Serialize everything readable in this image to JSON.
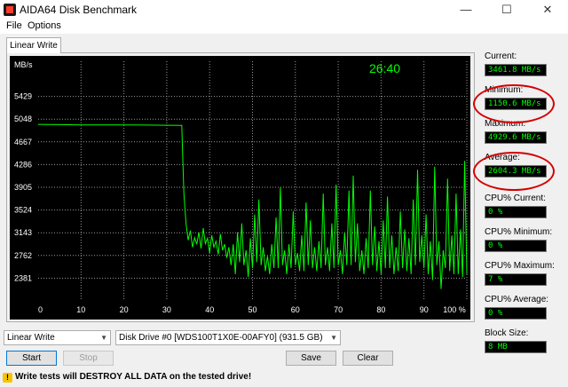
{
  "window": {
    "title": "AIDA64 Disk Benchmark",
    "minimize_glyph": "—",
    "maximize_glyph": "☐",
    "close_glyph": "✕"
  },
  "menu": {
    "items": [
      "File",
      "Options"
    ]
  },
  "tabs": [
    {
      "label": "Linear Write"
    }
  ],
  "chart": {
    "timer": "26:40",
    "y_unit": "MB/s",
    "line_color": "#00ff00",
    "background": "#000000",
    "grid_color": "#9a9a9a"
  },
  "chart_data": {
    "type": "line",
    "title": "",
    "xlabel": "",
    "ylabel": "MB/s",
    "xlim": [
      0,
      100
    ],
    "ylim": [
      2000,
      5810
    ],
    "grid": true,
    "x_ticks": [
      "0",
      "10",
      "20",
      "30",
      "40",
      "50",
      "60",
      "70",
      "80",
      "90",
      "100 %"
    ],
    "y_ticks": [
      "5429",
      "5048",
      "4667",
      "4286",
      "3905",
      "3524",
      "3143",
      "2762",
      "2381"
    ],
    "series": [
      {
        "color": "#00ff00",
        "points": [
          [
            0,
            4960
          ],
          [
            5,
            4955
          ],
          [
            10,
            4952
          ],
          [
            15,
            4950
          ],
          [
            20,
            4950
          ],
          [
            25,
            4948
          ],
          [
            30,
            4946
          ],
          [
            33.5,
            4944
          ],
          [
            34,
            3800
          ],
          [
            34.5,
            3300
          ],
          [
            35,
            3020
          ],
          [
            35.5,
            3180
          ],
          [
            36,
            2900
          ],
          [
            36.5,
            3060
          ],
          [
            37,
            2950
          ],
          [
            37.5,
            3150
          ],
          [
            38,
            2880
          ],
          [
            38.5,
            3220
          ],
          [
            39,
            2960
          ],
          [
            39.5,
            3050
          ],
          [
            40,
            2800
          ],
          [
            40.5,
            3100
          ],
          [
            41,
            2900
          ],
          [
            41.5,
            3000
          ],
          [
            42,
            2780
          ],
          [
            42.5,
            3120
          ],
          [
            43,
            2850
          ],
          [
            43.5,
            2950
          ],
          [
            44,
            2720
          ],
          [
            44.5,
            2900
          ],
          [
            45,
            2600
          ],
          [
            45.5,
            2950
          ],
          [
            46,
            2450
          ],
          [
            46.5,
            3150
          ],
          [
            47,
            2650
          ],
          [
            47.5,
            3300
          ],
          [
            48,
            2600
          ],
          [
            48.5,
            2850
          ],
          [
            49,
            2400
          ],
          [
            49.5,
            3050
          ],
          [
            50,
            2550
          ],
          [
            50.5,
            3450
          ],
          [
            51,
            2650
          ],
          [
            51.5,
            3700
          ],
          [
            52,
            2600
          ],
          [
            52.5,
            2900
          ],
          [
            53,
            2500
          ],
          [
            53.5,
            2750
          ],
          [
            54,
            2450
          ],
          [
            54.5,
            2950
          ],
          [
            55,
            2550
          ],
          [
            55.5,
            3400
          ],
          [
            56,
            2550
          ],
          [
            56.5,
            3900
          ],
          [
            57,
            2600
          ],
          [
            57.5,
            2850
          ],
          [
            58,
            2450
          ],
          [
            58.5,
            2950
          ],
          [
            59,
            2550
          ],
          [
            59.5,
            3500
          ],
          [
            60,
            2600
          ],
          [
            60.5,
            2800
          ],
          [
            61,
            2500
          ],
          [
            61.5,
            3100
          ],
          [
            62,
            2500
          ],
          [
            62.5,
            3650
          ],
          [
            63,
            2600
          ],
          [
            63.5,
            3350
          ],
          [
            64,
            2550
          ],
          [
            64.5,
            2900
          ],
          [
            65,
            2500
          ],
          [
            65.5,
            3000
          ],
          [
            66,
            2550
          ],
          [
            66.5,
            3800
          ],
          [
            67,
            2600
          ],
          [
            67.5,
            2900
          ],
          [
            68,
            2500
          ],
          [
            68.5,
            3300
          ],
          [
            69,
            2550
          ],
          [
            69.5,
            3950
          ],
          [
            70,
            2600
          ],
          [
            70.5,
            2850
          ],
          [
            71,
            2450
          ],
          [
            71.5,
            3150
          ],
          [
            72,
            2600
          ],
          [
            72.5,
            3850
          ],
          [
            73,
            2600
          ],
          [
            73.5,
            4100
          ],
          [
            74,
            2650
          ],
          [
            74.5,
            3300
          ],
          [
            75,
            2500
          ],
          [
            75.5,
            2850
          ],
          [
            76,
            2450
          ],
          [
            76.5,
            3050
          ],
          [
            77,
            2550
          ],
          [
            77.5,
            3850
          ],
          [
            78,
            2600
          ],
          [
            78.5,
            3250
          ],
          [
            79,
            2500
          ],
          [
            79.5,
            3000
          ],
          [
            80,
            2450
          ],
          [
            80.5,
            3350
          ],
          [
            81,
            2550
          ],
          [
            81.5,
            3750
          ],
          [
            82,
            2550
          ],
          [
            82.5,
            3100
          ],
          [
            83,
            2450
          ],
          [
            83.5,
            2900
          ],
          [
            84,
            2500
          ],
          [
            84.5,
            3500
          ],
          [
            85,
            2550
          ],
          [
            85.5,
            3200
          ],
          [
            86,
            2500
          ],
          [
            86.5,
            3050
          ],
          [
            87,
            2450
          ],
          [
            87.5,
            3700
          ],
          [
            88,
            2600
          ],
          [
            88.5,
            4200
          ],
          [
            89,
            2650
          ],
          [
            89.5,
            3100
          ],
          [
            90,
            2550
          ],
          [
            90.5,
            3450
          ],
          [
            91,
            2450
          ],
          [
            91.5,
            3000
          ],
          [
            92,
            2350
          ],
          [
            92.5,
            4250
          ],
          [
            93,
            2600
          ],
          [
            93.5,
            3000
          ],
          [
            94,
            2200
          ],
          [
            94.5,
            2850
          ],
          [
            95,
            2550
          ],
          [
            95.5,
            4050
          ],
          [
            96,
            2500
          ],
          [
            96.5,
            3100
          ],
          [
            97,
            2450
          ],
          [
            97.5,
            3800
          ],
          [
            98,
            2450
          ],
          [
            98.5,
            3200
          ],
          [
            99,
            2400
          ],
          [
            99.5,
            4350
          ],
          [
            100,
            2450
          ]
        ]
      }
    ]
  },
  "stats": [
    {
      "label": "Current:",
      "value": "3461.8 MB/s"
    },
    {
      "label": "Minimum:",
      "value": "1150.6 MB/s"
    },
    {
      "label": "Maximum:",
      "value": "4929.6 MB/s"
    },
    {
      "label": "Average:",
      "value": "2604.3 MB/s"
    },
    {
      "label": "CPU% Current:",
      "value": "0 %"
    },
    {
      "label": "CPU% Minimum:",
      "value": "0 %"
    },
    {
      "label": "CPU% Maximum:",
      "value": "7 %"
    },
    {
      "label": "CPU% Average:",
      "value": "0 %"
    },
    {
      "label": "Block Size:",
      "value": "8 MB"
    }
  ],
  "controls": {
    "test_select": "Linear Write",
    "drive_select": "Disk Drive #0  [WDS100T1X0E-00AFY0]  (931.5 GB)",
    "start": "Start",
    "stop": "Stop",
    "save": "Save",
    "clear": "Clear"
  },
  "warning": {
    "icon": "!",
    "text": "Write tests will DESTROY ALL DATA on the tested drive!"
  },
  "annotation_color": "#d40000"
}
